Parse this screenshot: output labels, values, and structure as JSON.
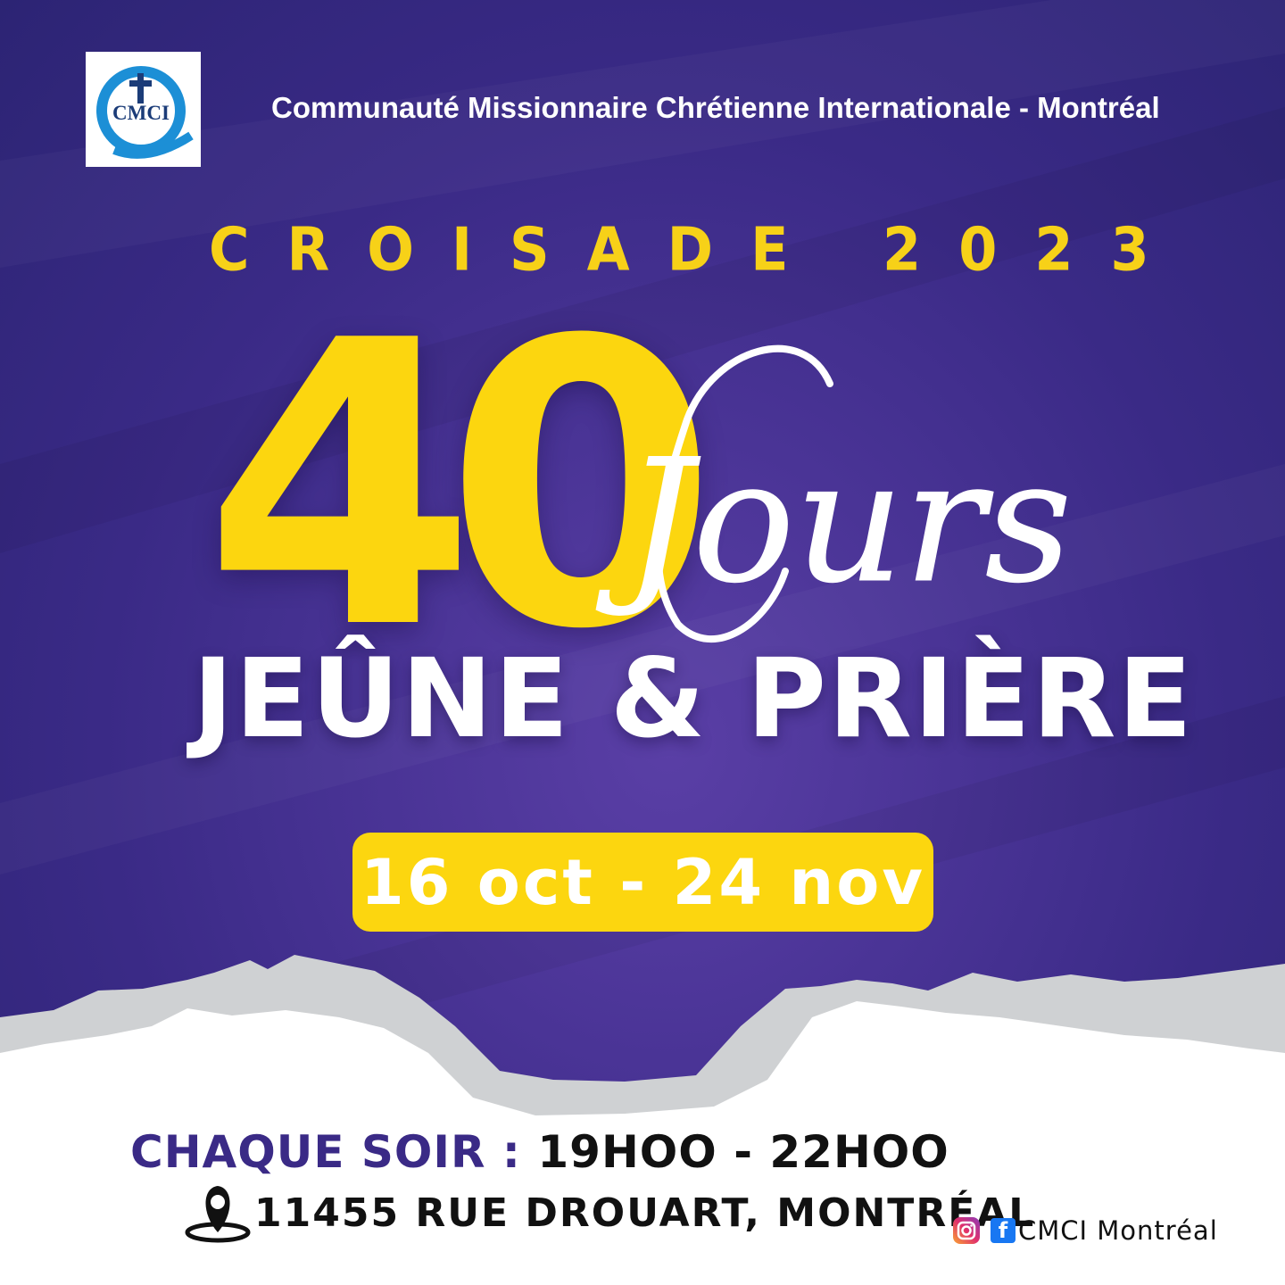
{
  "logo": {
    "text": "CMCI"
  },
  "header": {
    "organization": "Communauté Missionnaire Chrétienne Internationale - Montréal"
  },
  "event": {
    "campaign": "CROISADE 2023",
    "number": "40",
    "number_suffix": "Jours",
    "title": "JEÛNE & PRIÈRE",
    "dates": "16 oct - 24 nov"
  },
  "schedule": {
    "label": "CHAQUE SOIR :",
    "time": "19HOO - 22HOO",
    "address": "11455 RUE DROUART, MONTRÉAL"
  },
  "social": {
    "handle": "CMCI Montréal",
    "icons": [
      "instagram-icon",
      "facebook-icon"
    ]
  },
  "colors": {
    "background": "#3a2a86",
    "accent_yellow": "#fcd60f",
    "text_white": "#ffffff",
    "text_dark": "#111111",
    "schedule_purple": "#3a2a86",
    "mountain_gray": "#cfd1d3"
  }
}
